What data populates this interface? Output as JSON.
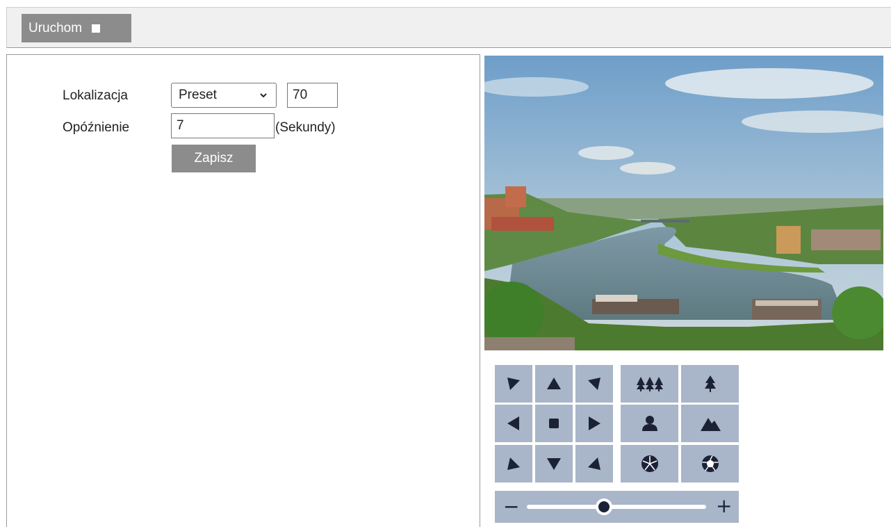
{
  "toolbar": {
    "run_label": "Uruchom"
  },
  "form": {
    "location_label": "Lokalizacja",
    "location_type": "Preset",
    "preset_number": "70",
    "delay_label": "Opóźnienie",
    "delay_value": "7",
    "delay_unit": "(Sekundy)",
    "save_label": "Zapisz"
  },
  "ptz": {
    "buttons": [
      {
        "name": "pan-up-left",
        "icon": "arrow-up-left-icon"
      },
      {
        "name": "pan-up",
        "icon": "arrow-up-icon"
      },
      {
        "name": "pan-up-right",
        "icon": "arrow-up-right-icon"
      },
      {
        "name": "pan-left",
        "icon": "arrow-left-icon"
      },
      {
        "name": "ptz-stop",
        "icon": "stop-icon"
      },
      {
        "name": "pan-right",
        "icon": "arrow-right-icon"
      },
      {
        "name": "pan-down-left",
        "icon": "arrow-down-left-icon"
      },
      {
        "name": "pan-down",
        "icon": "arrow-down-icon"
      },
      {
        "name": "pan-down-right",
        "icon": "arrow-down-right-icon"
      },
      {
        "name": "zoom-out",
        "icon": "trees-many-icon"
      },
      {
        "name": "zoom-in",
        "icon": "tree-single-icon"
      },
      {
        "name": "focus-near",
        "icon": "person-icon"
      },
      {
        "name": "focus-far",
        "icon": "mountain-icon"
      },
      {
        "name": "iris-close",
        "icon": "aperture-closed-icon"
      },
      {
        "name": "iris-open",
        "icon": "aperture-open-icon"
      }
    ],
    "speed_slider": {
      "minus": "−",
      "plus": "+",
      "value_fraction": 0.43
    }
  },
  "colors": {
    "button_gray": "#8c8c8c",
    "ptz_blue": "#a9b5c8",
    "icon_dark": "#1c2236"
  }
}
